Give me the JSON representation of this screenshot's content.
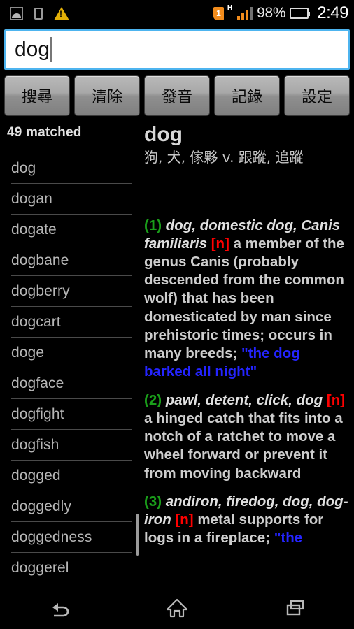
{
  "status_bar": {
    "icons": [
      "image-icon",
      "sdcard-icon",
      "warning-icon"
    ],
    "sim_label": "1",
    "network_type": "H",
    "battery_percent": "98%",
    "clock": "2:49"
  },
  "search": {
    "value": "dog",
    "placeholder": ""
  },
  "toolbar": {
    "buttons": [
      {
        "label": "搜尋",
        "name": "search-button"
      },
      {
        "label": "清除",
        "name": "clear-button"
      },
      {
        "label": "發音",
        "name": "pronounce-button"
      },
      {
        "label": "記錄",
        "name": "history-button"
      },
      {
        "label": "設定",
        "name": "settings-button"
      }
    ]
  },
  "results": {
    "matched_label": "49 matched",
    "words": [
      "dog",
      "dogan",
      "dogate",
      "dogbane",
      "dogberry",
      "dogcart",
      "doge",
      "dogface",
      "dogfight",
      "dogfish",
      "dogged",
      "doggedly",
      "doggedness",
      "doggerel"
    ]
  },
  "entry": {
    "word": "dog",
    "translation": "狗, 犬, 傢夥 v. 跟蹤, 追蹤",
    "definitions": [
      {
        "num": "(1)",
        "synonyms": "dog, domestic dog, Canis familiaris",
        "pos": "[n]",
        "body": "a member of the genus Canis (probably descended from the common wolf) that has been domesticated by man since prehistoric times; occurs in many breeds;",
        "example": "\"the dog barked all night\""
      },
      {
        "num": "(2)",
        "synonyms": "pawl, detent, click, dog",
        "pos": "[n]",
        "body": "a hinged catch that fits into a notch of a ratchet to move a wheel forward or prevent it from moving backward",
        "example": ""
      },
      {
        "num": "(3)",
        "synonyms": "andiron, firedog, dog, dog-iron",
        "pos": "[n]",
        "body": "metal supports for logs in a fireplace;",
        "example": "\"the"
      }
    ]
  },
  "nav_bar": {
    "back_label": "back-icon",
    "home_label": "home-icon",
    "recents_label": "recents-icon"
  },
  "colors": {
    "accent": "#4db4ef",
    "def_num": "#1a9e1a",
    "pos": "#ff0000",
    "example": "#2424ff",
    "battery": "#7cc440",
    "signal": "#f28c1c"
  }
}
